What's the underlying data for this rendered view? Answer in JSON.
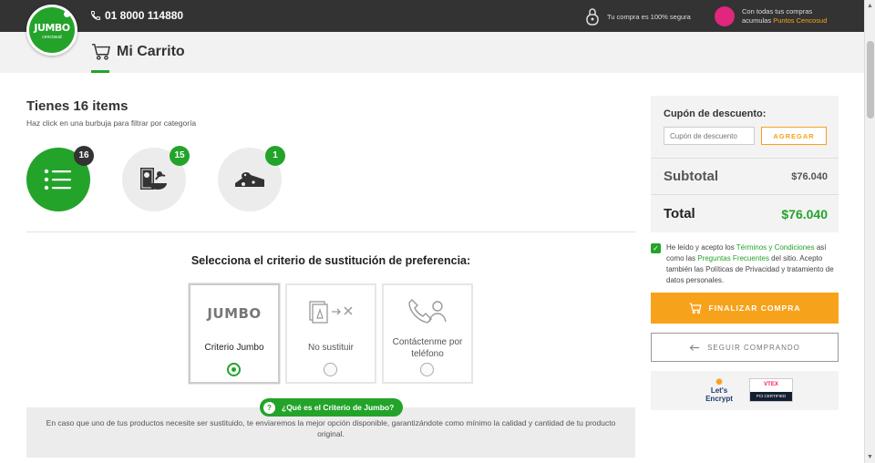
{
  "header": {
    "logo_text": "JUMBO",
    "logo_sub": "cencosud",
    "phone": "01 8000 114880",
    "secure_text": "Tu compra es 100% segura",
    "puntos_badge": "puntos cencosud",
    "puntos_line1": "Con todas tus compras",
    "puntos_line2_prefix": "acumulas ",
    "puntos_line2_highlight": "Puntos Cencosud"
  },
  "page": {
    "title": "Mi Carrito"
  },
  "cart": {
    "items_title": "Tienes 16 items",
    "items_hint": "Haz click en una burbuja para filtrar por categoría",
    "bubbles": [
      {
        "count": "16",
        "icon": "list-icon",
        "active": true
      },
      {
        "count": "15",
        "icon": "grocery-bag-icon",
        "active": false
      },
      {
        "count": "1",
        "icon": "cheese-icon",
        "active": false
      }
    ]
  },
  "substitution": {
    "title": "Selecciona el criterio de sustitución de preferencia:",
    "options": [
      {
        "label": "Criterio Jumbo",
        "brand": "JUMBO",
        "selected": true
      },
      {
        "label": "No sustituir",
        "selected": false
      },
      {
        "label": "Contáctenme por teléfono",
        "selected": false
      }
    ],
    "info_pill_q": "?",
    "info_pill": "¿Qué es el Criterio de Jumbo?",
    "info_text": "En caso que uno de tus productos necesite ser sustituido, te enviaremos la mejor opción disponible, garantizándote como mínimo la calidad y cantidad de tu producto original."
  },
  "summary": {
    "coupon_label": "Cupón de descuento:",
    "coupon_placeholder": "Cupón de descuento",
    "coupon_button": "AGREGAR",
    "subtotal_label": "Subtotal",
    "subtotal_value": "$76.040",
    "total_label": "Total",
    "total_value": "$76.040"
  },
  "terms": {
    "checked": true,
    "t1": "He leído y acepto los ",
    "link1": "Términos y Condiciones",
    "t2": " así como las ",
    "link2": "Preguntas Frecuentes",
    "t3": " del sitio. Acepto también las Políticas de Privacidad y tratamiento de datos personales."
  },
  "actions": {
    "finish": "FINALIZAR COMPRA",
    "continue": "SEGUIR COMPRANDO"
  },
  "trust": {
    "le_line1": "Let's",
    "le_line2": "Encrypt",
    "vtex": "VTEX",
    "vtex_sub": "PCI CERTIFIED"
  },
  "colors": {
    "brand_green": "#23a32a",
    "accent_orange": "#f7a21b",
    "topbar": "#333333"
  }
}
